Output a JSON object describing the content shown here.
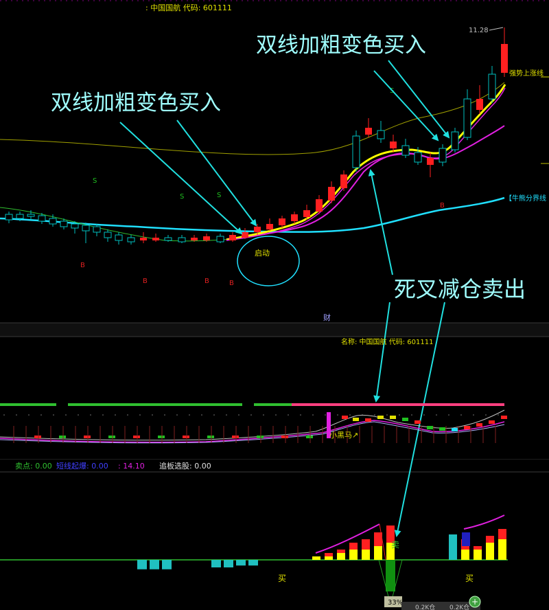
{
  "stock": {
    "name": "中国国航",
    "code": "601111",
    "header_text": ": 中国国航 代码: 601111",
    "panel2_header": "名称: 中国国航 代码: 601111"
  },
  "main_chart": {
    "high_price_label": "11.28",
    "strong_trend_label": "强势上涨线",
    "bull_bear_label": "【牛熊分界线",
    "start_label": "启动",
    "caifu_label": "财",
    "sb_markers": {
      "s": "S",
      "b": "B"
    }
  },
  "callouts": {
    "buy_1": "双线加粗变色买入",
    "buy_2": "双线加粗变色买入",
    "sell": "死叉减仓卖出"
  },
  "indicator_panel": {
    "dark_horse_label": "小黑马↗"
  },
  "status_bar": {
    "sell_point": "卖点: 0.00",
    "bottom_start": "短线起爆: 0.00",
    "value": ": 14.10",
    "chase_pick": "追板选股: 0.00"
  },
  "signal_panel": {
    "buy_label": "买",
    "sell_label": "卖",
    "percent_badge": "33%",
    "footer_a": "0.2K仓",
    "footer_b": "0.2K仓"
  },
  "colors": {
    "background": "#000000",
    "up": "#ff2020",
    "down": "#00c0c0",
    "ma_yellow": "#ffff00",
    "ma_magenta": "#e020e0",
    "bull_bear_line": "#20e0ff",
    "long_ma": "#a0a000",
    "callout_arrow": "#20e0e0",
    "callout_text": "#a0ffff"
  },
  "chart_data": {
    "type": "candlestick",
    "title": "中国国航 601111",
    "y_high_label": 11.28,
    "annotations": [
      "双线加粗变色买入",
      "双线加粗变色买入",
      "死叉减仓卖出",
      "启动"
    ],
    "sub_signal_bars": {
      "sell_bars_cyan": [
        5,
        5,
        5,
        0,
        0,
        0,
        4,
        4,
        3,
        3
      ],
      "buy_bars_red": [
        1,
        2,
        3,
        5,
        6,
        8,
        10
      ],
      "buy_bars_yellow": [
        1,
        1,
        2,
        3,
        3,
        4,
        5
      ],
      "right_buy_red": [
        6,
        4,
        7,
        9
      ],
      "right_buy_yellow": [
        3,
        3,
        5,
        6
      ]
    }
  }
}
